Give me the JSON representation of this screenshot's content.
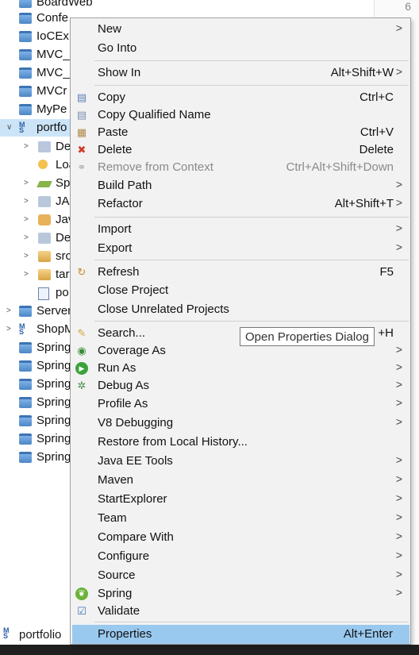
{
  "explorer": {
    "rows": [
      {
        "label": "BoardWeb",
        "arrow": "",
        "icon": "folder-icon"
      },
      {
        "label": "Confe",
        "arrow": "",
        "icon": "folder-icon"
      },
      {
        "label": "IoCEx",
        "arrow": "",
        "icon": "folder-icon"
      },
      {
        "label": "MVC_",
        "arrow": "",
        "icon": "folder-icon"
      },
      {
        "label": "MVC_",
        "arrow": "",
        "icon": "folder-icon"
      },
      {
        "label": "MVCr",
        "arrow": "",
        "icon": "folder-icon"
      },
      {
        "label": "MyPe",
        "arrow": "",
        "icon": "folder-icon"
      },
      {
        "label": "portfo",
        "arrow": "∨",
        "icon": "maven-project-icon"
      },
      {
        "label": "De",
        "arrow": ">",
        "icon": "deployment-descriptor-icon"
      },
      {
        "label": "Loa",
        "arrow": "",
        "icon": "spring-loader-icon"
      },
      {
        "label": "Spr",
        "arrow": ">",
        "icon": "spring-elements-icon"
      },
      {
        "label": "JAX",
        "arrow": ">",
        "icon": "jaxws-icon"
      },
      {
        "label": "Jav",
        "arrow": ">",
        "icon": "java-resources-icon"
      },
      {
        "label": "De",
        "arrow": ">",
        "icon": "deployed-resources-icon"
      },
      {
        "label": "src",
        "arrow": ">",
        "icon": "src-folder-icon"
      },
      {
        "label": "tar",
        "arrow": ">",
        "icon": "target-folder-icon"
      },
      {
        "label": "po",
        "arrow": "",
        "icon": "pom-file-icon"
      },
      {
        "label": "Server",
        "arrow": ">",
        "icon": "servers-folder-icon"
      },
      {
        "label": "ShopM",
        "arrow": ">",
        "icon": "maven-project-icon"
      },
      {
        "label": "Spring",
        "arrow": "",
        "icon": "folder-icon"
      },
      {
        "label": "Spring",
        "arrow": "",
        "icon": "folder-icon"
      },
      {
        "label": "Spring",
        "arrow": "",
        "icon": "folder-icon"
      },
      {
        "label": "Spring",
        "arrow": "",
        "icon": "folder-icon"
      },
      {
        "label": "Spring",
        "arrow": "",
        "icon": "folder-icon"
      },
      {
        "label": "Spring",
        "arrow": "",
        "icon": "folder-icon"
      },
      {
        "label": "Spring",
        "arrow": "",
        "icon": "folder-icon"
      }
    ],
    "status_project": "portfolio",
    "line_number": "6"
  },
  "menu": {
    "items": [
      {
        "label": "New",
        "shortcut": "",
        "submenu": true,
        "icon": ""
      },
      {
        "label": "Go Into",
        "shortcut": "",
        "submenu": false,
        "icon": ""
      },
      {
        "label": "Show In",
        "shortcut": "Alt+Shift+W",
        "submenu": true,
        "icon": ""
      },
      {
        "label": "Copy",
        "shortcut": "Ctrl+C",
        "submenu": false,
        "icon": "copy-icon"
      },
      {
        "label": "Copy Qualified Name",
        "shortcut": "",
        "submenu": false,
        "icon": "copy-qualified-name-icon"
      },
      {
        "label": "Paste",
        "shortcut": "Ctrl+V",
        "submenu": false,
        "icon": "paste-icon"
      },
      {
        "label": "Delete",
        "shortcut": "Delete",
        "submenu": false,
        "icon": "delete-icon"
      },
      {
        "label": "Remove from Context",
        "shortcut": "Ctrl+Alt+Shift+Down",
        "submenu": false,
        "icon": "remove-context-icon",
        "disabled": true
      },
      {
        "label": "Build Path",
        "shortcut": "",
        "submenu": true,
        "icon": ""
      },
      {
        "label": "Refactor",
        "shortcut": "Alt+Shift+T",
        "submenu": true,
        "icon": ""
      },
      {
        "label": "Import",
        "shortcut": "",
        "submenu": true,
        "icon": ""
      },
      {
        "label": "Export",
        "shortcut": "",
        "submenu": true,
        "icon": ""
      },
      {
        "label": "Refresh",
        "shortcut": "F5",
        "submenu": false,
        "icon": "refresh-icon"
      },
      {
        "label": "Close Project",
        "shortcut": "",
        "submenu": false,
        "icon": ""
      },
      {
        "label": "Close Unrelated Projects",
        "shortcut": "",
        "submenu": false,
        "icon": ""
      },
      {
        "label": "Search...",
        "shortcut": "+H",
        "submenu": false,
        "icon": "search-icon"
      },
      {
        "label": "Coverage As",
        "shortcut": "",
        "submenu": true,
        "icon": "coverage-icon"
      },
      {
        "label": "Run As",
        "shortcut": "",
        "submenu": true,
        "icon": "run-icon"
      },
      {
        "label": "Debug As",
        "shortcut": "",
        "submenu": true,
        "icon": "debug-icon"
      },
      {
        "label": "Profile As",
        "shortcut": "",
        "submenu": true,
        "icon": ""
      },
      {
        "label": "V8 Debugging",
        "shortcut": "",
        "submenu": true,
        "icon": ""
      },
      {
        "label": "Restore from Local History...",
        "shortcut": "",
        "submenu": false,
        "icon": ""
      },
      {
        "label": "Java EE Tools",
        "shortcut": "",
        "submenu": true,
        "icon": ""
      },
      {
        "label": "Maven",
        "shortcut": "",
        "submenu": true,
        "icon": ""
      },
      {
        "label": "StartExplorer",
        "shortcut": "",
        "submenu": true,
        "icon": ""
      },
      {
        "label": "Team",
        "shortcut": "",
        "submenu": true,
        "icon": ""
      },
      {
        "label": "Compare With",
        "shortcut": "",
        "submenu": true,
        "icon": ""
      },
      {
        "label": "Configure",
        "shortcut": "",
        "submenu": true,
        "icon": ""
      },
      {
        "label": "Source",
        "shortcut": "",
        "submenu": true,
        "icon": ""
      },
      {
        "label": "Spring",
        "shortcut": "",
        "submenu": true,
        "icon": "spring-icon"
      },
      {
        "label": "Validate",
        "shortcut": "",
        "submenu": false,
        "icon": "validate-checkbox-icon"
      },
      {
        "label": "Properties",
        "shortcut": "Alt+Enter",
        "submenu": false,
        "icon": "",
        "highlighted": true
      }
    ],
    "submenu_arrow": ">"
  },
  "tooltip": {
    "text": "Open Properties Dialog"
  }
}
